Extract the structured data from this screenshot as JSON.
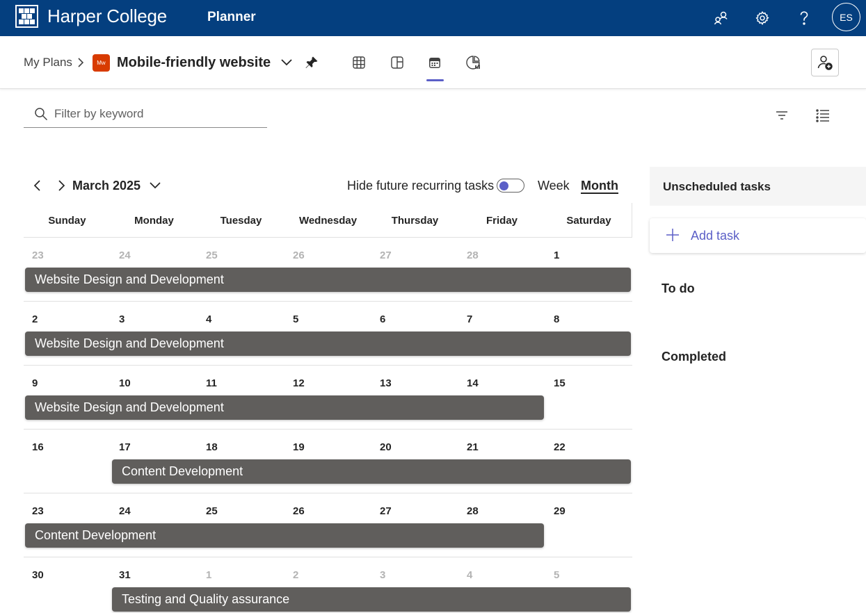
{
  "appbar": {
    "brand": "Harper College",
    "app_name": "Planner",
    "avatar_initials": "ES",
    "icons": [
      "people-connect-icon",
      "gear-icon",
      "help-icon"
    ],
    "bg_color": "#043f7f"
  },
  "plan": {
    "breadcrumb_root": "My Plans",
    "plan_icon_text": "Mw",
    "plan_icon_color": "#d83b01",
    "title": "Mobile-friendly website",
    "views": [
      "grid-view-icon",
      "board-view-icon",
      "schedule-view-icon",
      "charts-view-icon"
    ],
    "active_view": "schedule-view-icon",
    "accent_color": "#5b5fc7"
  },
  "filter": {
    "placeholder": "Filter by keyword",
    "value": ""
  },
  "calendar": {
    "month_label": "March 2025",
    "hide_recurring_label": "Hide future recurring tasks",
    "hide_recurring_on": false,
    "week_label": "Week",
    "month_view_label": "Month",
    "active_mode": "Month",
    "days_of_week": [
      "Sunday",
      "Monday",
      "Tuesday",
      "Wednesday",
      "Thursday",
      "Friday",
      "Saturday"
    ],
    "weeks": [
      {
        "days": [
          {
            "n": "23",
            "muted": true
          },
          {
            "n": "24",
            "muted": true
          },
          {
            "n": "25",
            "muted": true
          },
          {
            "n": "26",
            "muted": true
          },
          {
            "n": "27",
            "muted": true
          },
          {
            "n": "28",
            "muted": true
          },
          {
            "n": "1",
            "muted": false
          }
        ],
        "bar": {
          "label": "Website Design and Development",
          "start": 0,
          "span": 7
        }
      },
      {
        "days": [
          {
            "n": "2",
            "muted": false
          },
          {
            "n": "3",
            "muted": false
          },
          {
            "n": "4",
            "muted": false
          },
          {
            "n": "5",
            "muted": false
          },
          {
            "n": "6",
            "muted": false
          },
          {
            "n": "7",
            "muted": false
          },
          {
            "n": "8",
            "muted": false
          }
        ],
        "bar": {
          "label": "Website Design and Development",
          "start": 0,
          "span": 7
        }
      },
      {
        "days": [
          {
            "n": "9",
            "muted": false
          },
          {
            "n": "10",
            "muted": false
          },
          {
            "n": "11",
            "muted": false
          },
          {
            "n": "12",
            "muted": false
          },
          {
            "n": "13",
            "muted": false
          },
          {
            "n": "14",
            "muted": false
          },
          {
            "n": "15",
            "muted": false
          }
        ],
        "bar": {
          "label": "Website Design and Development",
          "start": 0,
          "span": 6
        }
      },
      {
        "days": [
          {
            "n": "16",
            "muted": false
          },
          {
            "n": "17",
            "muted": false
          },
          {
            "n": "18",
            "muted": false
          },
          {
            "n": "19",
            "muted": false
          },
          {
            "n": "20",
            "muted": false
          },
          {
            "n": "21",
            "muted": false
          },
          {
            "n": "22",
            "muted": false
          }
        ],
        "bar": {
          "label": "Content Development",
          "start": 1,
          "span": 6
        }
      },
      {
        "days": [
          {
            "n": "23",
            "muted": false
          },
          {
            "n": "24",
            "muted": false
          },
          {
            "n": "25",
            "muted": false
          },
          {
            "n": "26",
            "muted": false
          },
          {
            "n": "27",
            "muted": false
          },
          {
            "n": "28",
            "muted": false
          },
          {
            "n": "29",
            "muted": false
          }
        ],
        "bar": {
          "label": "Content Development",
          "start": 0,
          "span": 6
        }
      },
      {
        "days": [
          {
            "n": "30",
            "muted": false
          },
          {
            "n": "31",
            "muted": false
          },
          {
            "n": "1",
            "muted": true
          },
          {
            "n": "2",
            "muted": true
          },
          {
            "n": "3",
            "muted": true
          },
          {
            "n": "4",
            "muted": true
          },
          {
            "n": "5",
            "muted": true
          }
        ],
        "bar": {
          "label": "Testing and Quality assurance",
          "start": 1,
          "span": 6
        }
      }
    ],
    "bar_color": "#605e5c"
  },
  "panel": {
    "title": "Unscheduled tasks",
    "add_task_label": "Add task",
    "sections": [
      "To do",
      "Completed"
    ]
  }
}
